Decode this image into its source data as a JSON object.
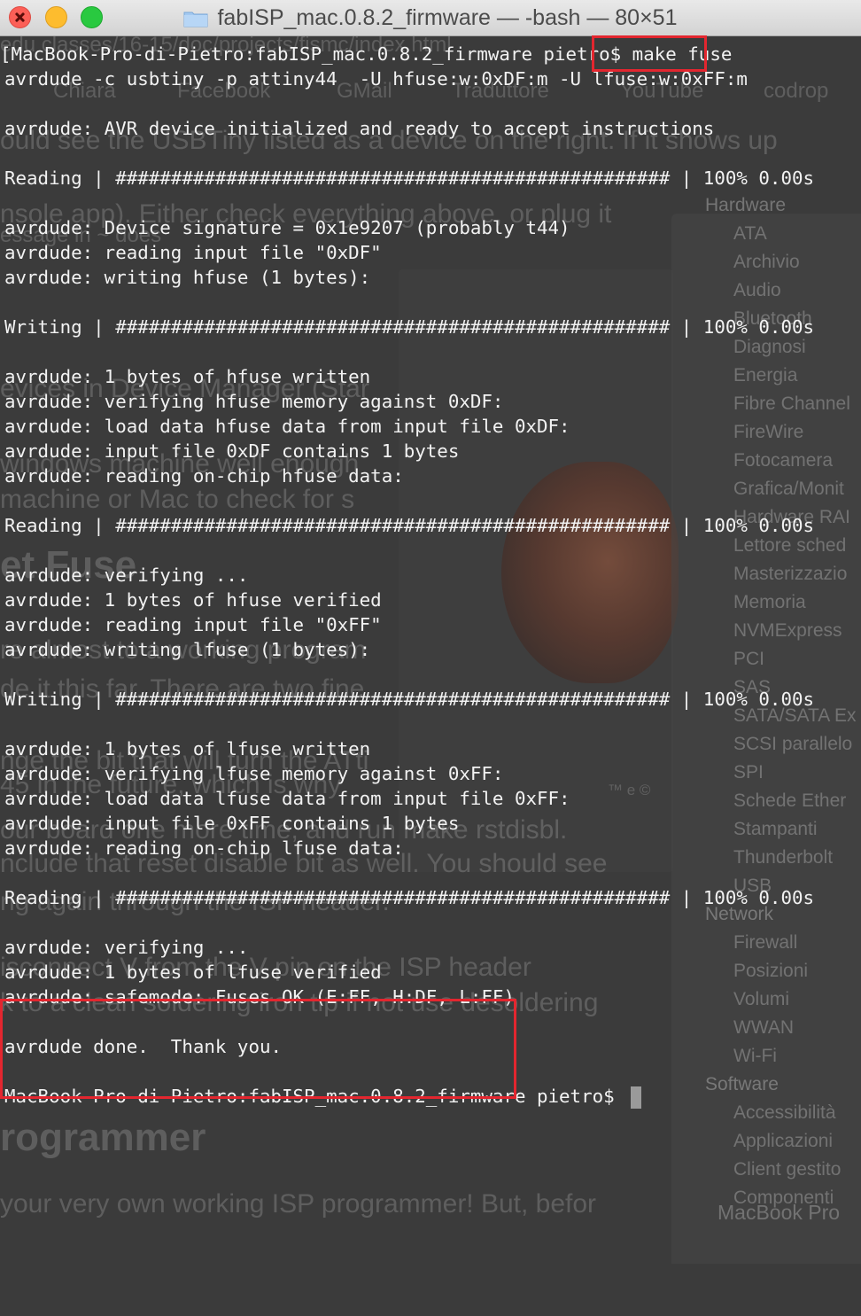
{
  "window": {
    "title": "fabISP_mac.0.8.2_firmware — -bash — 80×51",
    "folder_icon": "folder-icon",
    "controls": [
      "close-icon",
      "minimize-icon",
      "zoom-icon"
    ]
  },
  "terminal": {
    "lines": [
      "[MacBook-Pro-di-Pietro:fabISP_mac.0.8.2_firmware pietro$ make fuse",
      "avrdude -c usbtiny -p attiny44  -U hfuse:w:0xDF:m -U lfuse:w:0xFF:m",
      "",
      "avrdude: AVR device initialized and ready to accept instructions",
      "",
      "Reading | ################################################## | 100% 0.00s",
      "",
      "avrdude: Device signature = 0x1e9207 (probably t44)",
      "avrdude: reading input file \"0xDF\"",
      "avrdude: writing hfuse (1 bytes):",
      "",
      "Writing | ################################################## | 100% 0.00s",
      "",
      "avrdude: 1 bytes of hfuse written",
      "avrdude: verifying hfuse memory against 0xDF:",
      "avrdude: load data hfuse data from input file 0xDF:",
      "avrdude: input file 0xDF contains 1 bytes",
      "avrdude: reading on-chip hfuse data:",
      "",
      "Reading | ################################################## | 100% 0.00s",
      "",
      "avrdude: verifying ...",
      "avrdude: 1 bytes of hfuse verified",
      "avrdude: reading input file \"0xFF\"",
      "avrdude: writing lfuse (1 bytes):",
      "",
      "Writing | ################################################## | 100% 0.00s",
      "",
      "avrdude: 1 bytes of lfuse written",
      "avrdude: verifying lfuse memory against 0xFF:",
      "avrdude: load data lfuse data from input file 0xFF:",
      "avrdude: input file 0xFF contains 1 bytes",
      "avrdude: reading on-chip lfuse data:",
      "",
      "Reading | ################################################## | 100% 0.00s",
      "",
      "avrdude: verifying ...",
      "avrdude: 1 bytes of lfuse verified",
      "avrdude: safemode: Fuses OK (E:FF, H:DF, L:FF)",
      "",
      "avrdude done.  Thank you.",
      "",
      "MacBook-Pro-di-Pietro:fabISP_mac.0.8.2_firmware pietro$ "
    ],
    "highlight_color": "#e3262f"
  },
  "background": {
    "page_fragments": [
      "edu classes/16-15/doc/projects/fismc/index.html",
      "ould see the USBTiny listed as a device on the right. If it shows up",
      "nsole app). Either check everything above, or plug it",
      "essage in ~ does",
      "evices in Device Manager (Star",
      "windows machine well enough",
      "machine or Mac to check for s",
      "et Fuse",
      "re almost to a working program",
      "de it this far. There are two fine",
      "nge the bit that will turn the ATti",
      "45 in the future, which is why",
      "our board one more time, and run make rstdisbl.",
      "nclude that reset disable bit as well. You should see",
      "ng again through the ISP header.",
      "isconnect V   from the V   pin on the ISP header",
      "k to a clean soldering iron tip if not use desoldering",
      "rogrammer",
      "your very own working ISP programmer! But, befor"
    ],
    "bookmarks": [
      "Chiara",
      "Facebook",
      "GMail",
      "Traduttore",
      "YouTube",
      "codrop"
    ],
    "system_info": {
      "hardware_header": "Hardware",
      "hardware": [
        "ATA",
        "Archivio",
        "Audio",
        "Bluetooth",
        "Diagnosi",
        "Energia",
        "Fibre Channel",
        "FireWire",
        "Fotocamera",
        "Grafica/Monit",
        "Hardware RAI",
        "Lettore sched",
        "Masterizzazio",
        "Memoria",
        "NVMExpress",
        "PCI",
        "SAS",
        "SATA/SATA Ex",
        "SCSI parallelo",
        "SPI",
        "Schede Ether",
        "Stampanti",
        "Thunderbolt",
        "USB"
      ],
      "network_header": "Network",
      "network": [
        "Firewall",
        "Posizioni",
        "Volumi",
        "WWAN",
        "Wi-Fi"
      ],
      "software_header": "Software",
      "software": [
        "Accessibilità",
        "Applicazioni",
        "Client gestito",
        "Componenti"
      ],
      "footer": "MacBook Pro"
    },
    "trademark": "™ e ©"
  }
}
